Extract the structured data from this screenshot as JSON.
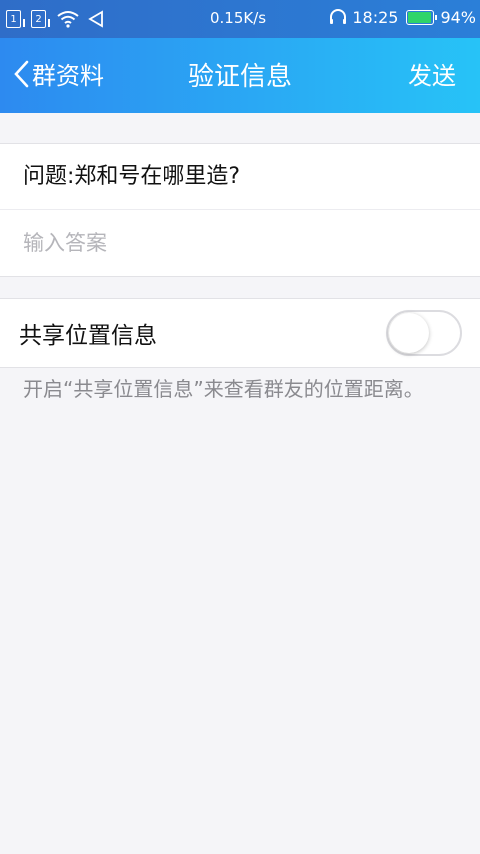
{
  "status_bar": {
    "sim1": "1",
    "sim2": "2",
    "net_speed": "0.15K/s",
    "time": "18:25",
    "battery": "94%",
    "battery_level": 0.94,
    "icons": [
      "wifi-icon",
      "nfc-icon",
      "headset-icon",
      "battery-icon"
    ]
  },
  "nav": {
    "back_label": "群资料",
    "title": "验证信息",
    "send_label": "发送"
  },
  "question": {
    "text": "问题:郑和号在哪里造?"
  },
  "answer": {
    "placeholder": "输入答案",
    "value": ""
  },
  "share_location": {
    "label": "共享位置信息",
    "enabled": false,
    "hint": "开启“共享位置信息”来查看群友的位置距离。"
  },
  "colors": {
    "nav_gradient_start": "#2d8af0",
    "nav_gradient_end": "#27c3f7",
    "battery_fill": "#2fd46a",
    "background": "#f5f5f8"
  }
}
